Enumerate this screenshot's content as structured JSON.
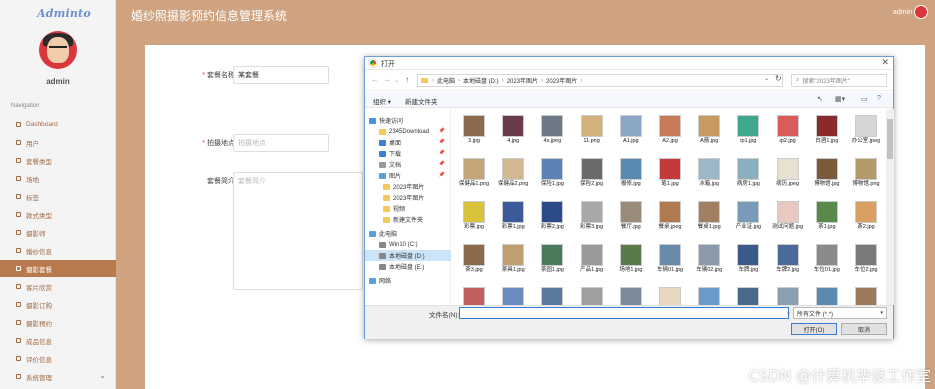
{
  "app": {
    "logo": "Adminto",
    "title": "婚纱照摄影预约信息管理系统",
    "user": "admin"
  },
  "sidebar": {
    "user": "admin",
    "nav_label": "Navigation",
    "items": [
      {
        "label": "Dashboard"
      },
      {
        "label": "用户"
      },
      {
        "label": "套餐类型"
      },
      {
        "label": "场地"
      },
      {
        "label": "标签"
      },
      {
        "label": "款式类型"
      },
      {
        "label": "摄影师"
      },
      {
        "label": "婚纱信息"
      },
      {
        "label": "摄影套餐"
      },
      {
        "label": "客片欣赏"
      },
      {
        "label": "摄影订购"
      },
      {
        "label": "摄影预约"
      },
      {
        "label": "成品信息"
      },
      {
        "label": "评价信息"
      },
      {
        "label": "系统管理"
      }
    ]
  },
  "form": {
    "name_label": "套餐名称",
    "name_value": "某套餐",
    "place_label": "拍摄地点",
    "place_placeholder": "拍摄地点",
    "desc_label": "套餐简介",
    "desc_placeholder": "套餐简介"
  },
  "dialog": {
    "title": "打开",
    "path": [
      "此电脑",
      "本地磁盘 (D:)",
      "2023年图片",
      "2023年图片"
    ],
    "search_placeholder": "搜索\"2023年图片\"",
    "organize": "组织 ▾",
    "new_folder": "新建文件夹",
    "tree": [
      {
        "label": "快速访问",
        "color": "#4a90e2"
      },
      {
        "label": "2345Download",
        "color": "#f5c85a",
        "pin": true
      },
      {
        "label": "桌面",
        "color": "#3c7fd6",
        "pin": true
      },
      {
        "label": "下载",
        "color": "#3c7fd6",
        "pin": true
      },
      {
        "label": "文档",
        "color": "#999999",
        "pin": true
      },
      {
        "label": "图片",
        "color": "#5aa0e0",
        "pin": true
      },
      {
        "label": "2023年图片",
        "color": "#f5c85a"
      },
      {
        "label": "2023年图片",
        "color": "#f5c85a"
      },
      {
        "label": "视频",
        "color": "#f5c85a"
      },
      {
        "label": "新建文件夹",
        "color": "#f5c85a"
      },
      {
        "label": "此电脑",
        "color": "#5aa0e0"
      },
      {
        "label": "Win10 (C:)",
        "color": "#888888"
      },
      {
        "label": "本地磁盘 (D:)",
        "color": "#888888",
        "selected": true
      },
      {
        "label": "本地磁盘 (E:)",
        "color": "#888888"
      },
      {
        "label": "网络",
        "color": "#5aa0e0"
      }
    ],
    "files": [
      {
        "name": "3.jpg",
        "color": "#8b6a4d"
      },
      {
        "name": "4.jpg",
        "color": "#6a3c4a"
      },
      {
        "name": "4s.jpeg",
        "color": "#6d7a86"
      },
      {
        "name": "11.png",
        "color": "#d2b27a"
      },
      {
        "name": "A1.jpg",
        "color": "#8aa7c6"
      },
      {
        "name": "A2.jpg",
        "color": "#c77a55"
      },
      {
        "name": "A筋.jpg",
        "color": "#c79a60"
      },
      {
        "name": "ip1.jpg",
        "color": "#3fa78e"
      },
      {
        "name": "ip2.jpg",
        "color": "#d85c5c"
      },
      {
        "name": "白酒1.jpg",
        "color": "#8a2a2a"
      },
      {
        "name": "办公室.jpeg",
        "color": "#d6d6d6"
      },
      {
        "name": "保健品1.png",
        "color": "#c4a57a"
      },
      {
        "name": "保健品2.png",
        "color": "#d2b890"
      },
      {
        "name": "保险1.jpg",
        "color": "#5a82b4"
      },
      {
        "name": "保险2.jpg",
        "color": "#6a6a6a"
      },
      {
        "name": "报修.jpg",
        "color": "#5a8ab0"
      },
      {
        "name": "笔1.jpg",
        "color": "#c23a3a"
      },
      {
        "name": "冰箱.jpg",
        "color": "#9eb7c7"
      },
      {
        "name": "病房1.jpg",
        "color": "#8ab0c0"
      },
      {
        "name": "病历.jpeg",
        "color": "#e8e0d0"
      },
      {
        "name": "博物馆.jpg",
        "color": "#7a5a3a"
      },
      {
        "name": "博物馆.png",
        "color": "#b49a6a"
      },
      {
        "name": "彩票.jpg",
        "color": "#d8c23a"
      },
      {
        "name": "彩票1.jpg",
        "color": "#3a5a9a"
      },
      {
        "name": "彩票2.jpg",
        "color": "#2a4a8a"
      },
      {
        "name": "彩票3.jpg",
        "color": "#a8a8a8"
      },
      {
        "name": "餐厅.jpg",
        "color": "#9a8a7a"
      },
      {
        "name": "餐桌.jpeg",
        "color": "#b07a50"
      },
      {
        "name": "餐桌1.jpg",
        "color": "#a08060"
      },
      {
        "name": "产业证.jpg",
        "color": "#7a9aba"
      },
      {
        "name": "测试问题.jpg",
        "color": "#e8c8c0"
      },
      {
        "name": "茶1.jpg",
        "color": "#5a8a4a"
      },
      {
        "name": "茶2.jpg",
        "color": "#d8a060"
      },
      {
        "name": "茶3.jpg",
        "color": "#8a6a4a"
      },
      {
        "name": "茶具1.jpg",
        "color": "#c0a070"
      },
      {
        "name": "茶园1.jpg",
        "color": "#4a7a5a"
      },
      {
        "name": "产品1.jpg",
        "color": "#9a9a9a"
      },
      {
        "name": "场地1.jpg",
        "color": "#5a7a4a"
      },
      {
        "name": "车辆01.jpg",
        "color": "#6a8aaa"
      },
      {
        "name": "车辆02.jpg",
        "color": "#8a9aaa"
      },
      {
        "name": "车牌.jpg",
        "color": "#3a5a8a"
      },
      {
        "name": "车牌2.jpg",
        "color": "#4a6a9a"
      },
      {
        "name": "车位01.jpg",
        "color": "#8a8a8a"
      },
      {
        "name": "车位2.jpg",
        "color": "#7a7a7a"
      },
      {
        "name": "",
        "color": "#c06060"
      },
      {
        "name": "",
        "color": "#6a8ac0"
      },
      {
        "name": "",
        "color": "#5a7aa0"
      },
      {
        "name": "",
        "color": "#a0a0a0"
      },
      {
        "name": "",
        "color": "#7a8a9a"
      },
      {
        "name": "",
        "color": "#e8d8c0"
      },
      {
        "name": "",
        "color": "#6a9ac8"
      },
      {
        "name": "",
        "color": "#4a6a8a"
      },
      {
        "name": "",
        "color": "#8aa0b0"
      },
      {
        "name": "",
        "color": "#5a8ab0"
      },
      {
        "name": "",
        "color": "#9a7a5a"
      }
    ],
    "filename_label": "文件名(N):",
    "filename_value": "",
    "filetype": "所有文件 (*.*)",
    "open_button": "打开(O)",
    "cancel_button": "取消"
  },
  "watermark": "CSDN @计算机毕设工作室",
  "colors": {
    "accent": "#b77b4f",
    "topbar": "#cfa37f",
    "nav_text": "#a06a45"
  }
}
